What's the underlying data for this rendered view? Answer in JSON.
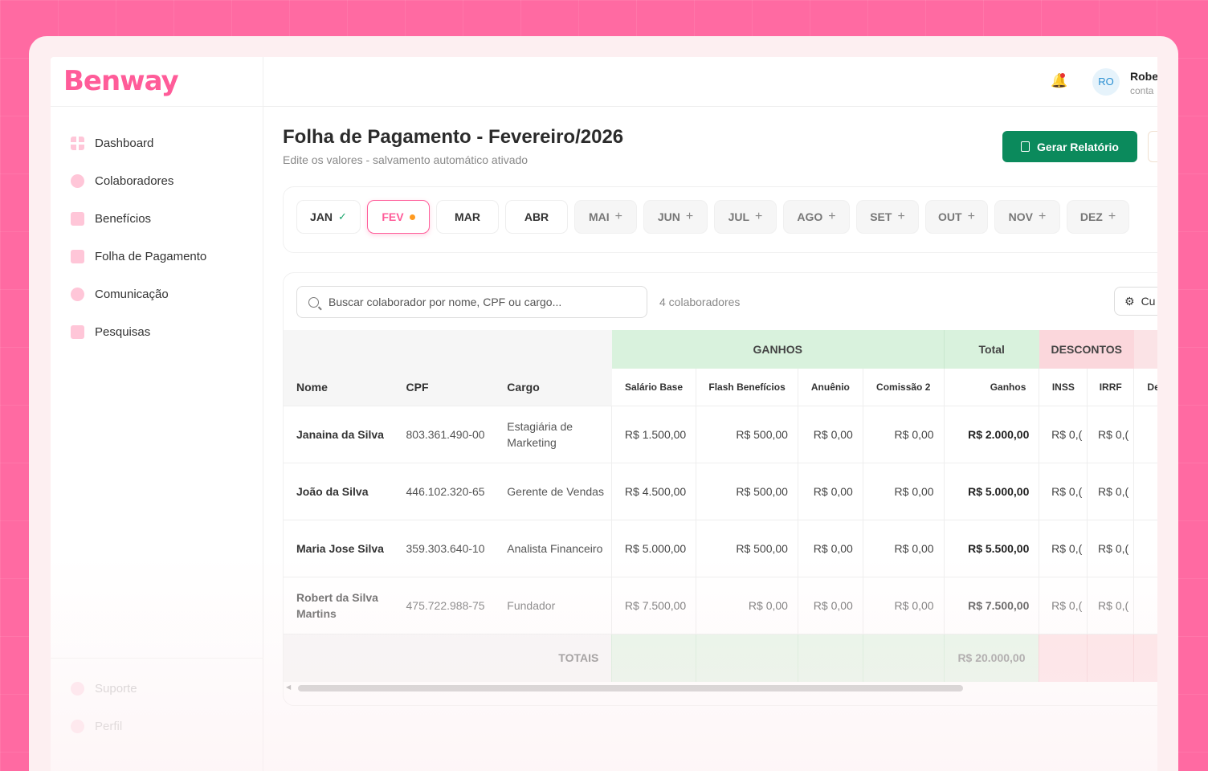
{
  "brand": {
    "logo_text": "Benway",
    "accent": "#ff5c99",
    "green": "#0b8a5c"
  },
  "sidebar": {
    "items": [
      {
        "label": "Dashboard",
        "icon": "dashboard-grid-icon"
      },
      {
        "label": "Colaboradores",
        "icon": "users-icon"
      },
      {
        "label": "Benefícios",
        "icon": "gift-icon"
      },
      {
        "label": "Folha de Pagamento",
        "icon": "payroll-icon"
      },
      {
        "label": "Comunicação",
        "icon": "chat-icon"
      },
      {
        "label": "Pesquisas",
        "icon": "survey-icon"
      }
    ],
    "bottom": [
      {
        "label": "Suporte",
        "icon": "support-icon"
      },
      {
        "label": "Perfil",
        "icon": "profile-icon"
      }
    ]
  },
  "header": {
    "avatar_initials": "RO",
    "user_name": "Robe",
    "user_sub": "conta"
  },
  "page": {
    "title": "Folha de Pagamento - Fevereiro/2026",
    "subtitle": "Edite os valores - salvamento automático ativado",
    "report_button": "Gerar Relatório"
  },
  "months": [
    {
      "label": "JAN",
      "state": "done"
    },
    {
      "label": "FEV",
      "state": "active"
    },
    {
      "label": "MAR",
      "state": "open"
    },
    {
      "label": "ABR",
      "state": "open"
    },
    {
      "label": "MAI",
      "state": "future"
    },
    {
      "label": "JUN",
      "state": "future"
    },
    {
      "label": "JUL",
      "state": "future"
    },
    {
      "label": "AGO",
      "state": "future"
    },
    {
      "label": "SET",
      "state": "future"
    },
    {
      "label": "OUT",
      "state": "future"
    },
    {
      "label": "NOV",
      "state": "future"
    },
    {
      "label": "DEZ",
      "state": "future"
    }
  ],
  "table": {
    "search_placeholder": "Buscar colaborador por nome, CPF ou cargo...",
    "count": "4 colaboradores",
    "custom_button": "Cu",
    "groups": {
      "ganhos": "GANHOS",
      "total": "Total",
      "descontos": "DESCONTOS"
    },
    "headers": {
      "nome": "Nome",
      "cpf": "CPF",
      "cargo": "Cargo",
      "salario": "Salário Base",
      "flash": "Flash Benefícios",
      "anuenio": "Anuênio",
      "comissao": "Comissão 2",
      "ganhos": "Ganhos",
      "inss": "INSS",
      "irrf": "IRRF",
      "extra": "De"
    },
    "rows": [
      {
        "nome": "Janaina da Silva",
        "cpf": "803.361.490-00",
        "cargo": "Estagiária de Marketing",
        "salario": "R$ 1.500,00",
        "flash": "R$ 500,00",
        "anuenio": "R$ 0,00",
        "comissao": "R$ 0,00",
        "ganhos": "R$ 2.000,00",
        "inss": "R$ 0,(",
        "irrf": "R$ 0,("
      },
      {
        "nome": "João da Silva",
        "cpf": "446.102.320-65",
        "cargo": "Gerente de Vendas",
        "salario": "R$ 4.500,00",
        "flash": "R$ 500,00",
        "anuenio": "R$ 0,00",
        "comissao": "R$ 0,00",
        "ganhos": "R$ 5.000,00",
        "inss": "R$ 0,(",
        "irrf": "R$ 0,("
      },
      {
        "nome": "Maria Jose Silva",
        "cpf": "359.303.640-10",
        "cargo": "Analista Financeiro",
        "salario": "R$ 5.000,00",
        "flash": "R$ 500,00",
        "anuenio": "R$ 0,00",
        "comissao": "R$ 0,00",
        "ganhos": "R$ 5.500,00",
        "inss": "R$ 0,(",
        "irrf": "R$ 0,("
      },
      {
        "nome": "Robert da Silva Martins",
        "cpf": "475.722.988-75",
        "cargo": "Fundador",
        "salario": "R$ 7.500,00",
        "flash": "R$ 0,00",
        "anuenio": "R$ 0,00",
        "comissao": "R$ 0,00",
        "ganhos": "R$ 7.500,00",
        "inss": "R$ 0,(",
        "irrf": "R$ 0,("
      }
    ],
    "totals_label": "TOTAIS",
    "totals_ganhos": "R$ 20.000,00"
  }
}
